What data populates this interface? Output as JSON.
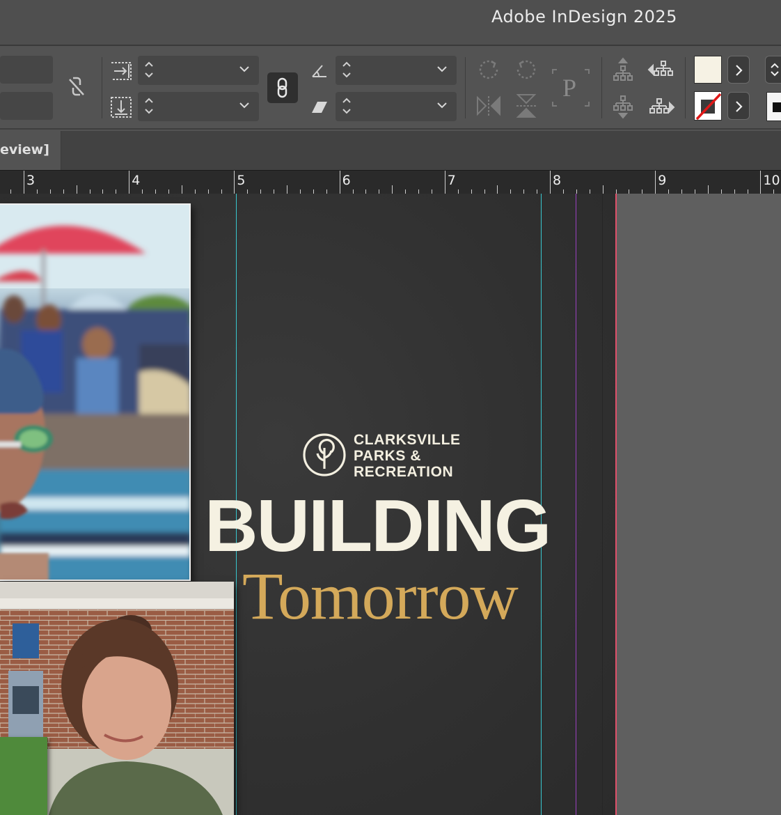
{
  "window": {
    "title": "Adobe InDesign 2025"
  },
  "tab": {
    "label": "eview]"
  },
  "ruler": {
    "labels": [
      "3",
      "4",
      "5",
      "6",
      "7",
      "8",
      "9",
      "10"
    ]
  },
  "colors": {
    "fill_swatch": "#f6f2e4",
    "accent_gold": "#d4a95a",
    "headline_cream": "#f5f1e2",
    "page_dark": "#333333",
    "bleed_guide": "#e0506a",
    "margin_guide": "#38c8d0",
    "column_guide": "#9b40c0"
  },
  "control_panel": {
    "icons": [
      "unlink-icon",
      "text-wrap-right-icon",
      "text-wrap-down-icon",
      "constrain-link-icon",
      "rotation-angle-icon",
      "shear-angle-icon",
      "rotate-cw-icon",
      "rotate-ccw-icon",
      "flip-horizontal-icon",
      "flip-vertical-icon",
      "p-reference-point-icon",
      "select-container-icon",
      "select-previous-icon",
      "select-content-icon",
      "select-next-icon",
      "fill-swatch-icon",
      "stroke-none-swatch-icon"
    ]
  },
  "document": {
    "logo_lines": [
      "CLARKSVILLE",
      "PARKS &",
      "RECREATION"
    ],
    "headline": "BUILDING",
    "subheadline": "Tomorrow"
  }
}
